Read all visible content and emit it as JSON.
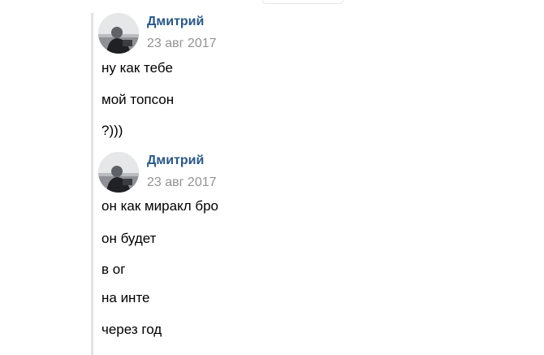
{
  "groups": [
    {
      "author": "Дмитрий",
      "date": "23 авг 2017",
      "messages": [
        "ну как тебе",
        "мой топсон",
        "?)))"
      ]
    },
    {
      "author": "Дмитрий",
      "date": "23 авг 2017",
      "messages": [
        "он как миракл бро",
        "он будет",
        "в ог",
        "на инте",
        "через год"
      ]
    }
  ],
  "colors": {
    "author_link": "#2a5885",
    "date_text": "#939393",
    "message_text": "#000000",
    "quote_bar": "#dfe3e8"
  }
}
